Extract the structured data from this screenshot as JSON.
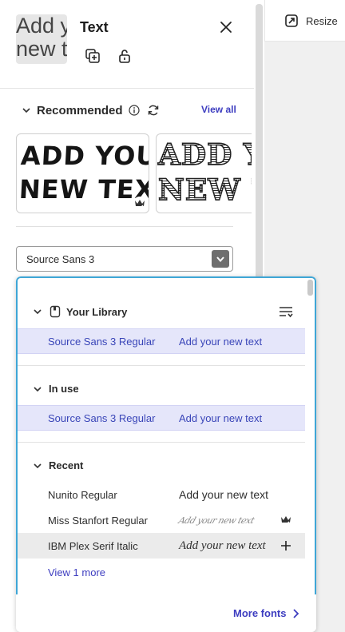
{
  "panel": {
    "title": "Text",
    "thumbnail_line1": "Add y",
    "thumbnail_line2": "new t"
  },
  "recommended": {
    "label": "Recommended",
    "view_all": "View all",
    "cards": [
      {
        "line1": "ADD YOUR",
        "line2": "NEW TEXT"
      },
      {
        "line1": "ADD YO",
        "line2": "NEW TE"
      }
    ]
  },
  "font_select": {
    "value": "Source Sans 3"
  },
  "topbar": {
    "resize_label": "Resize"
  },
  "dropdown": {
    "sections": {
      "library": {
        "label": "Your Library"
      },
      "in_use": {
        "label": "In use"
      },
      "recent": {
        "label": "Recent"
      }
    },
    "library_row": {
      "name": "Source Sans 3 Regular",
      "sample": "Add your new text"
    },
    "in_use_row": {
      "name": "Source Sans 3 Regular",
      "sample": "Add your new text"
    },
    "recent_rows": [
      {
        "name": "Nunito Regular",
        "sample": "Add your new text"
      },
      {
        "name": "Miss Stanfort Regular",
        "sample": "Add your new text"
      },
      {
        "name": "IBM Plex Serif Italic",
        "sample": "Add your new text"
      }
    ],
    "view_more": "View 1 more",
    "more_fonts": "More fonts"
  },
  "colors": {
    "accent": "#3d3dc0",
    "selected_row": "#e5e6fa",
    "focus_border": "#3ea6d6"
  }
}
